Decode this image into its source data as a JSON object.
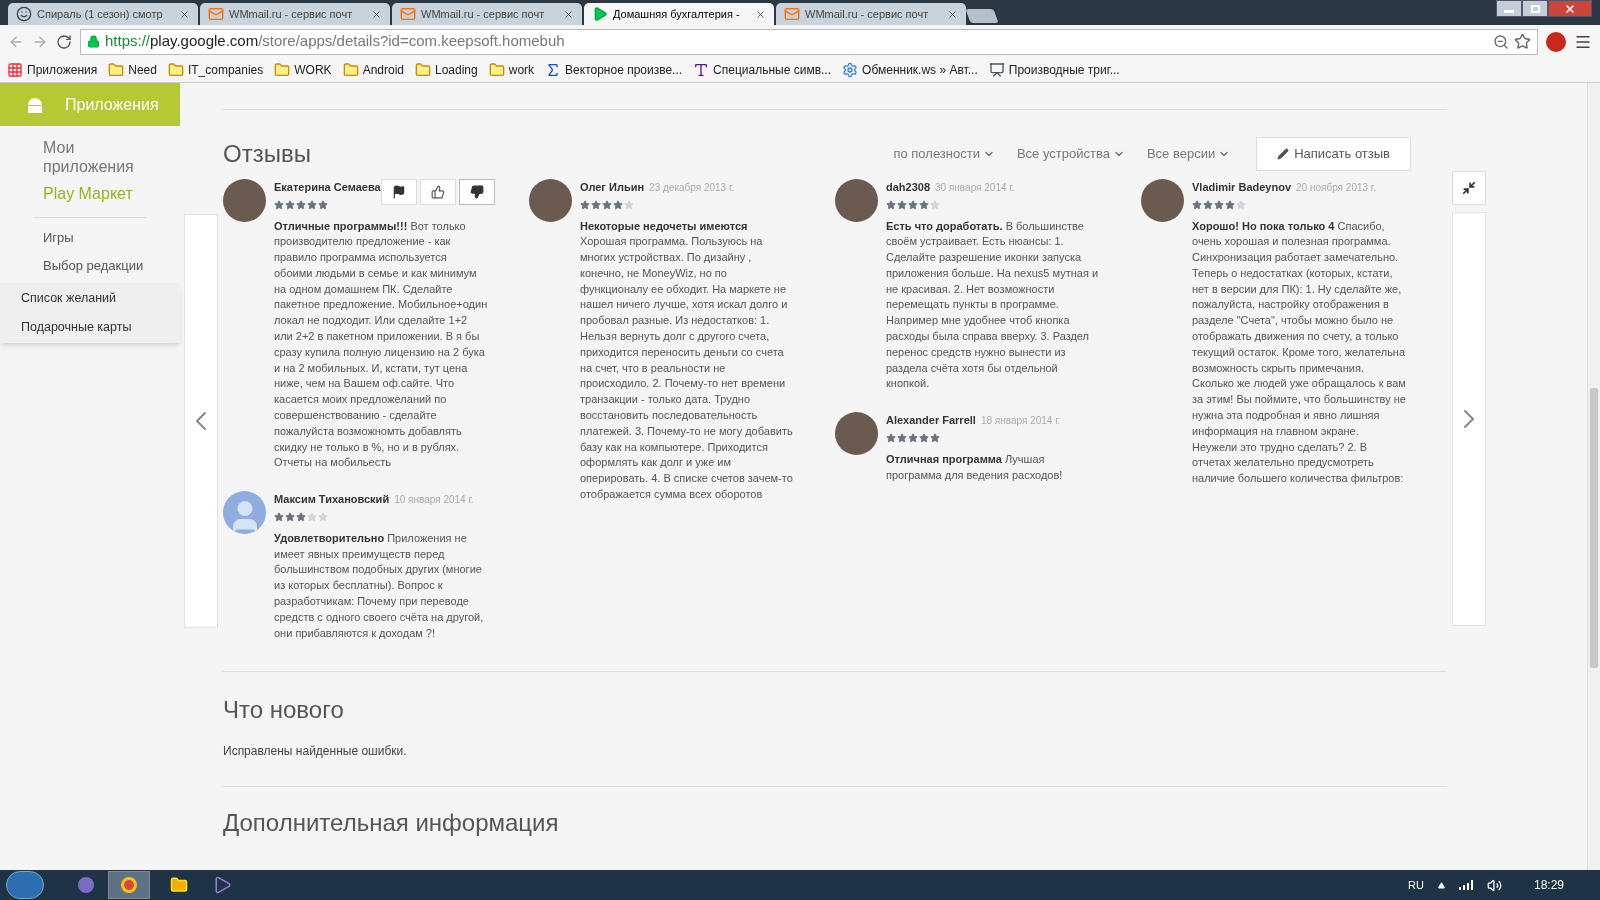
{
  "browser": {
    "tabs": [
      {
        "title": "Спираль (1 сезон) смотр",
        "selected": false,
        "kind": "face"
      },
      {
        "title": "WMmail.ru - сервис почт",
        "selected": false,
        "kind": "mail"
      },
      {
        "title": "WMmail.ru - сервис почт",
        "selected": false,
        "kind": "mail"
      },
      {
        "title": "Домашняя бухгалтерия -",
        "selected": true,
        "kind": "play"
      },
      {
        "title": "WMmail.ru - сервис почт",
        "selected": false,
        "kind": "mail"
      }
    ],
    "url": {
      "scheme": "https://",
      "host": "play.google.com",
      "path": "/store/apps/details?id=com.keepsoft.homebuh"
    },
    "bookmarks": [
      {
        "label": "Приложения",
        "kind": "apps"
      },
      {
        "label": "Need",
        "kind": "folder"
      },
      {
        "label": "IT_companies",
        "kind": "folder"
      },
      {
        "label": "WORK",
        "kind": "folder"
      },
      {
        "label": "Android",
        "kind": "folder"
      },
      {
        "label": "Loading",
        "kind": "folder"
      },
      {
        "label": "work",
        "kind": "folder"
      },
      {
        "label": "Векторное произве...",
        "kind": "formula"
      },
      {
        "label": "Специальные симв...",
        "kind": "letter"
      },
      {
        "label": "Обменник.ws » Авт...",
        "kind": "gear"
      },
      {
        "label": "Производные триг...",
        "kind": "board"
      }
    ]
  },
  "sidebar": {
    "header": "Приложения",
    "items": [
      {
        "label": "Мои приложения",
        "selected": false
      },
      {
        "label": "Play Маркет",
        "selected": true
      }
    ],
    "sub_items": [
      "Игры",
      "Выбор редакции"
    ],
    "menu": [
      "Список желаний",
      "Подарочные карты"
    ]
  },
  "reviews": {
    "title": "Отзывы",
    "filters": [
      "по полезности",
      "Все устройства",
      "Все версии"
    ],
    "write_button": "Написать отзыв",
    "columns": [
      [
        {
          "author": "Екатерина Семаева",
          "stars": 5,
          "kind": "photo",
          "show_actions": true,
          "title": "Отличные программы!!!",
          "text": "Вот только производителю предложение - как правило программа используется обоими людьми в семье и как минимум на одном домашнем ПК. Сделайте пакетное предложение. Мобильное+один локал не подходит. Или сделайте 1+2 или 2+2 в пакетном приложении. В я бы сразу купила полную лицензию на 2 бука и на 2 мобильных. И, кстати, тут цена ниже, чем на Вашем оф.сайте. Что касается моих предложеланий по совершенствованию - сделайте пожалуйста возможномть добавлять скидку не только в %, но и в рублях. Отчеты на мобильесть"
        },
        {
          "author": "Максим Тихановский",
          "date": "10 января 2014 г.",
          "stars": 3,
          "kind": "silhouette",
          "show_actions": false,
          "title": "Удовлетворительно",
          "text": "Приложения не имеет явных преимуществ перед большинством подобных других (многие из которых бесплатны). Вопрос к разработчикам: Почему при переводе средств с одного своего счёта на другой, они прибавляются к доходам ?!"
        }
      ],
      [
        {
          "author": "Олег Ильин",
          "date": "23 декабря 2013 г.",
          "stars": 4,
          "kind": "photo",
          "show_actions": false,
          "title": "Некоторые недочеты имеются",
          "text": "Хорошая программа. Пользуюсь на многих устройствах. По дизайну , конечно, не MoneyWiz, но по функционалу ее обходит. На маркете не нашел ничего лучше, хотя искал долго и пробовал разные. Из недостатков: 1. Нельзя вернуть долг с другого счета, приходится переносить деньги со счета на счет, что в реальности не происходило. 2. Почему-то нет времени транзакции - только дата. Трудно восстановить последовательность платежей. 3. Почему-то не могу добавить базу как на компьютере. Приходится оформлять как долг и уже им оперировать. 4. В списке счетов зачем-то отображается сумма всех оборотов"
        }
      ],
      [
        {
          "author": "dah2308",
          "date": "30 января 2014 г.",
          "stars": 4,
          "kind": "photo",
          "show_actions": false,
          "title": "Есть что доработать.",
          "text": "В большинстве своём устраивает. Есть нюансы: 1. Сделайте разрешение иконки запуска приложения больше. На nexus5 мутная и не красивая. 2. Нет возможности перемещать пункты в программе. Например мне удобнее чтоб кнопка расходы была справа вверху. 3. Раздел перенос средств нужно вынести из раздела счёта хотя бы отдельной кнопкой."
        },
        {
          "author": "Alexander Farrell",
          "date": "18 января 2014 г.",
          "stars": 5,
          "kind": "photo",
          "show_actions": false,
          "title": "Отличная программа",
          "text": "Лучшая программа для ведения расходов!"
        }
      ],
      [
        {
          "author": "Vladimir Badeynov",
          "date": "20 ноября 2013 г.",
          "stars": 4,
          "kind": "photo",
          "show_actions": false,
          "title": "Хорошо! Но пока только 4",
          "text": "Спасибо, очень хорошая и полезная программа. Синхронизация работает замечательно. Теперь о недостатках (которых, кстати, нет в версии для ПК): 1. Ну сделайте же, пожалуйста, настройку отображения в разделе \"Счета\", чтобы можно было не отображать движения по счету, а только текущий остаток. Кроме того, желательна возможность скрыть примечания. Сколько же людей уже обращалось к вам за этим! Вы поймите, что большинству не нужна эта подробная и явно лишняя информация на главном экране. Неужели это трудно сделать? 2. В отчетах желательно предусмотреть наличие большего количества фильтров:"
        }
      ]
    ]
  },
  "whats_new": {
    "title": "Что нового",
    "text": "Исправлены найденные ошибки."
  },
  "more_info": {
    "title": "Дополнительная информация"
  },
  "taskbar": {
    "language": "RU",
    "time": "18:29"
  }
}
